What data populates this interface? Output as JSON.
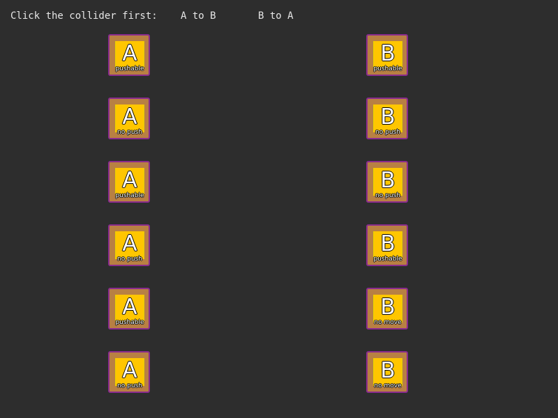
{
  "header": {
    "prompt": "Click the collider first:",
    "option_a_to_b": "A to B",
    "option_b_to_a": "B to A"
  },
  "rows": [
    {
      "a": {
        "letter": "A",
        "label": "pushable"
      },
      "b": {
        "letter": "B",
        "label": "pushable"
      }
    },
    {
      "a": {
        "letter": "A",
        "label": "no push"
      },
      "b": {
        "letter": "B",
        "label": "no push"
      }
    },
    {
      "a": {
        "letter": "A",
        "label": "pushable"
      },
      "b": {
        "letter": "B",
        "label": "no push"
      }
    },
    {
      "a": {
        "letter": "A",
        "label": "no push"
      },
      "b": {
        "letter": "B",
        "label": "pushable"
      }
    },
    {
      "a": {
        "letter": "A",
        "label": "pushable"
      },
      "b": {
        "letter": "B",
        "label": "no move"
      }
    },
    {
      "a": {
        "letter": "A",
        "label": "no push"
      },
      "b": {
        "letter": "B",
        "label": "no move"
      }
    }
  ],
  "colors": {
    "background": "#2d2d2d",
    "box_fill": "#b88043",
    "box_border": "#8a2b8e",
    "inner_fill": "#ffc600",
    "text": "#e6e6e6"
  }
}
